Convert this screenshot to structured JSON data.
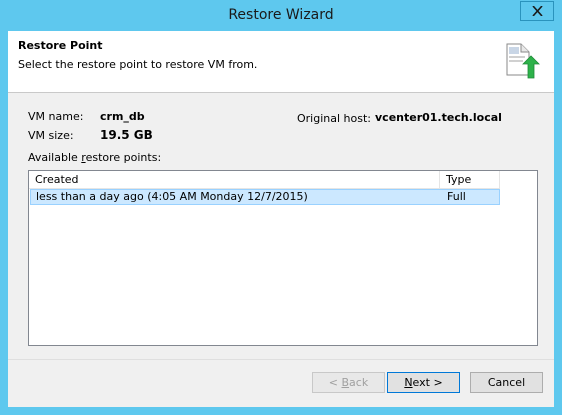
{
  "window": {
    "title": "Restore Wizard"
  },
  "header": {
    "title": "Restore Point",
    "description": "Select the restore point to restore VM from.",
    "icon": "restore-document-arrow-icon"
  },
  "vm": {
    "name_label": "VM name:",
    "name_value": "crm_db",
    "size_label": "VM size:",
    "size_value": "19.5 GB",
    "host_label": "Original host:",
    "host_value": "vcenter01.tech.local"
  },
  "restore_points": {
    "label_pre": "Available ",
    "label_accel": "r",
    "label_post": "estore points:",
    "columns": [
      "Created",
      "Type"
    ],
    "rows": [
      {
        "created": "less than a day ago (4:05 AM Monday 12/7/2015)",
        "type": "Full",
        "selected": true
      }
    ]
  },
  "buttons": {
    "back_pre": "< ",
    "back_accel": "B",
    "back_post": "ack",
    "next_accel": "N",
    "next_post": "ext >",
    "cancel": "Cancel"
  },
  "colors": {
    "titlebar": "#5ec8ee",
    "selection": "#cce8ff",
    "accent_green": "#2db24a"
  }
}
